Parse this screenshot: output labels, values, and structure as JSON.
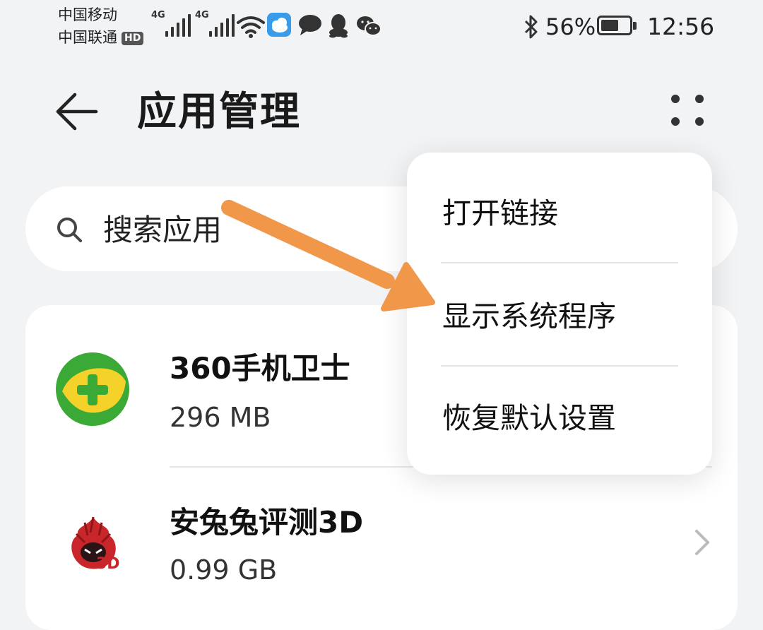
{
  "status_bar": {
    "carrier1": "中国移动",
    "carrier2": "中国联通",
    "hd_badge": "HD",
    "signal1_label": "4G",
    "signal2_label": "4G",
    "battery_percent": "56%",
    "time": "12:56",
    "icons": [
      "wifi-icon",
      "weather-icon",
      "chat-bubble-icon",
      "qq-icon",
      "wechat-icon",
      "bluetooth-icon",
      "battery-icon"
    ]
  },
  "header": {
    "title": "应用管理"
  },
  "search": {
    "placeholder": "搜索应用"
  },
  "apps": [
    {
      "name": "360手机卫士",
      "size": "296 MB"
    },
    {
      "name": "安兔兔评测3D",
      "size": "0.99 GB",
      "badge": "3D"
    }
  ],
  "menu": {
    "items": [
      "打开链接",
      "显示系统程序",
      "恢复默认设置"
    ]
  },
  "colors": {
    "background": "#f1f3f5",
    "surface": "#ffffff",
    "annotation_arrow": "#f0974a",
    "app360_green": "#3aa935",
    "app360_yellow": "#f5d22a",
    "antutu_red": "#c8262a"
  }
}
